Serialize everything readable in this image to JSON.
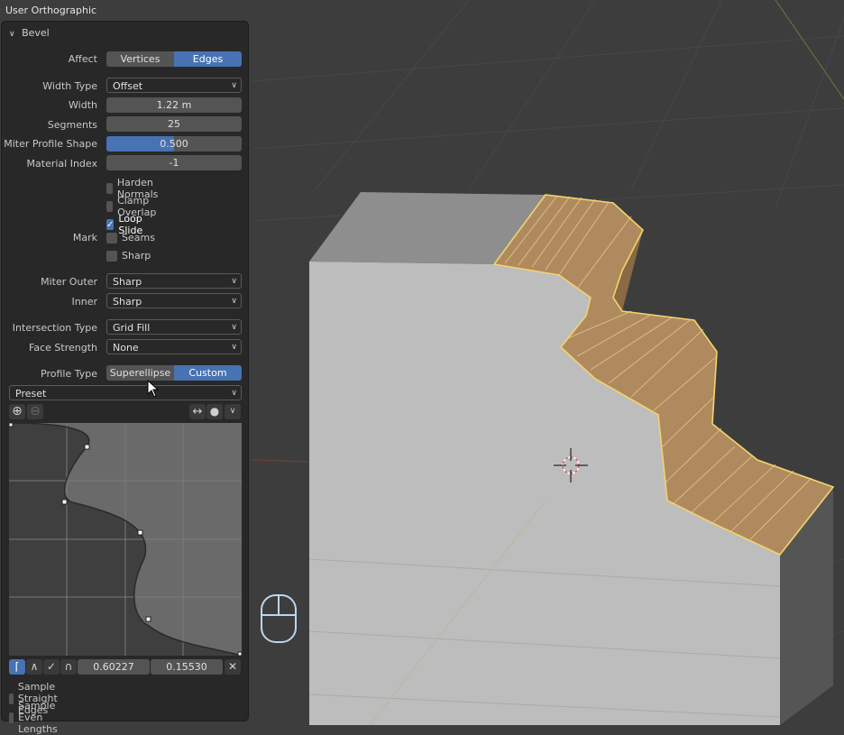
{
  "viewport": {
    "title": "User Orthographic"
  },
  "panel": {
    "header": "Bevel",
    "affect": {
      "label": "Affect",
      "options": [
        "Vertices",
        "Edges"
      ],
      "selected": "Edges"
    },
    "width_type": {
      "label": "Width Type",
      "value": "Offset"
    },
    "width": {
      "label": "Width",
      "value": "1.22 m"
    },
    "segments": {
      "label": "Segments",
      "value": "25"
    },
    "miter_profile_shape": {
      "label": "Miter Profile Shape",
      "value": "0.500",
      "fraction": 0.5
    },
    "material_index": {
      "label": "Material Index",
      "value": "-1"
    },
    "harden_normals": {
      "label": "Harden Normals",
      "checked": false
    },
    "clamp_overlap": {
      "label": "Clamp Overlap",
      "checked": false
    },
    "loop_slide": {
      "label": "Loop Slide",
      "checked": true
    },
    "mark": {
      "label": "Mark",
      "seams": "Seams",
      "sharp": "Sharp"
    },
    "miter_outer": {
      "label": "Miter Outer",
      "value": "Sharp"
    },
    "inner": {
      "label": "Inner",
      "value": "Sharp"
    },
    "intersection_type": {
      "label": "Intersection Type",
      "value": "Grid Fill"
    },
    "face_strength": {
      "label": "Face Strength",
      "value": "None"
    },
    "profile_type": {
      "label": "Profile Type",
      "options": [
        "Superellipse",
        "Custom"
      ],
      "selected": "Custom"
    },
    "preset": {
      "value": "Preset"
    },
    "curve_values": {
      "x": "0.60227",
      "y": "0.15530"
    },
    "sample_straight_edges": {
      "label": "Sample Straight Edges",
      "checked": false
    },
    "sample_even_lengths": {
      "label": "Sample Even Lengths",
      "checked": false
    }
  },
  "colors": {
    "accent": "#4772b3",
    "selection": "#f2d46e",
    "bevel_face": "#b08a5f"
  },
  "icons": [
    "chevron-down-icon",
    "add-point-icon",
    "remove-point-icon",
    "swap-icon",
    "dot-icon",
    "handle-auto-icon",
    "handle-vector-icon",
    "handle-free-icon",
    "handle-aligned-icon",
    "close-icon",
    "mouse-icon",
    "3d-cursor-icon",
    "pointer-icon"
  ]
}
